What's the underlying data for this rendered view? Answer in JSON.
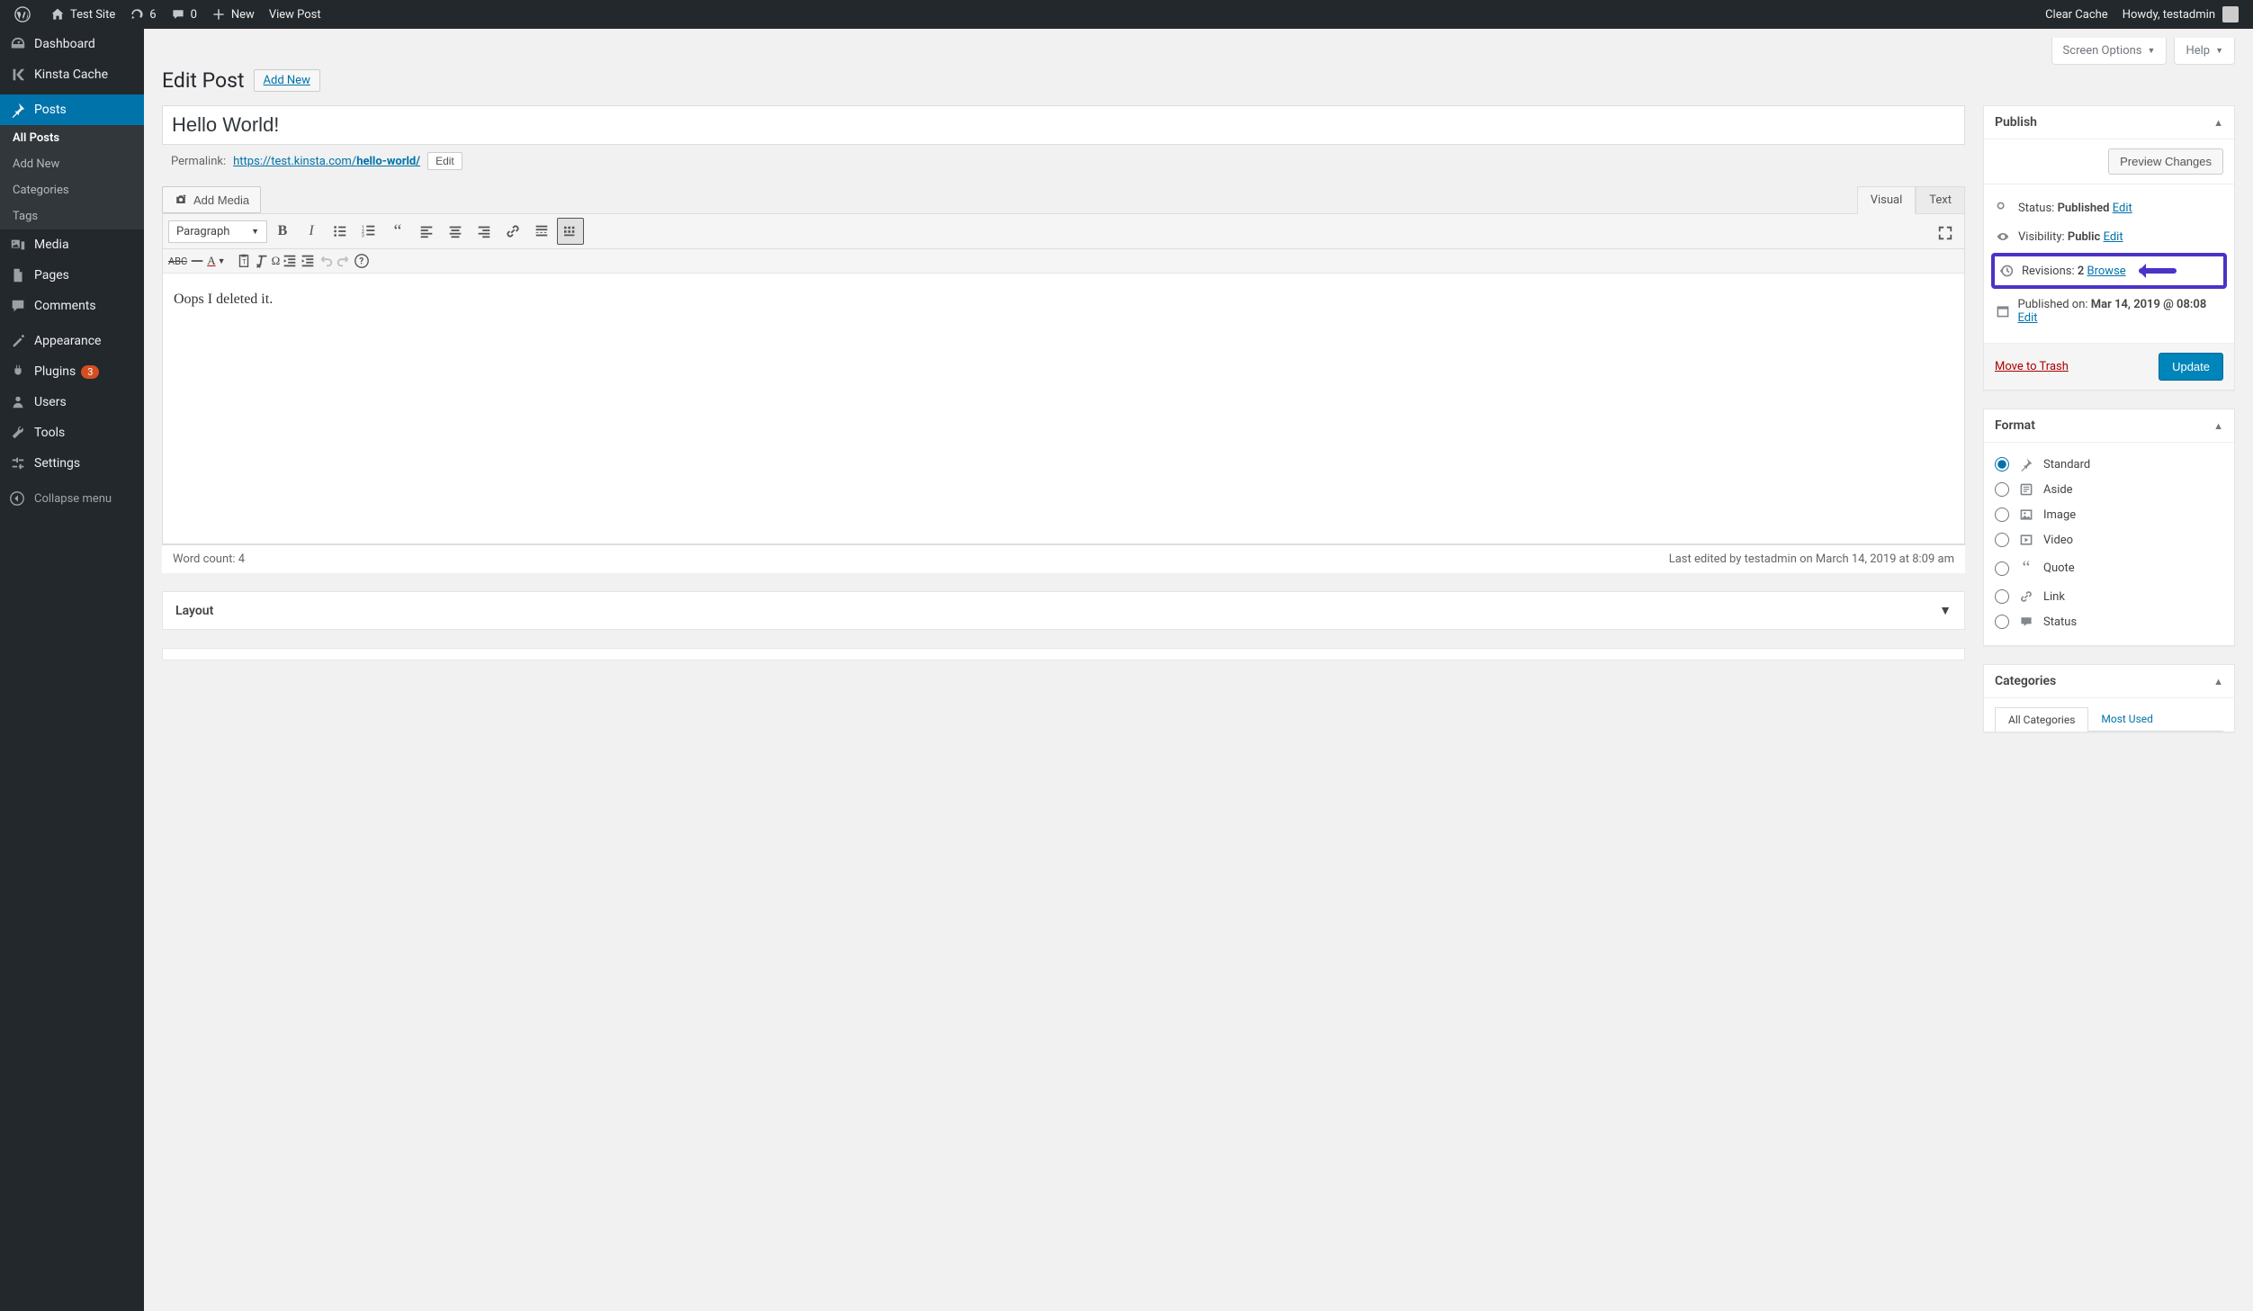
{
  "adminbar": {
    "site_name": "Test Site",
    "updates": "6",
    "comments": "0",
    "new": "New",
    "view_post": "View Post",
    "clear_cache": "Clear Cache",
    "howdy": "Howdy, testadmin"
  },
  "menu": {
    "dashboard": "Dashboard",
    "kinsta": "Kinsta Cache",
    "posts": "Posts",
    "posts_sub": {
      "all": "All Posts",
      "add": "Add New",
      "cats": "Categories",
      "tags": "Tags"
    },
    "media": "Media",
    "pages": "Pages",
    "comments": "Comments",
    "appearance": "Appearance",
    "plugins": "Plugins",
    "plugins_badge": "3",
    "users": "Users",
    "tools": "Tools",
    "settings": "Settings",
    "collapse": "Collapse menu"
  },
  "screen_meta": {
    "options": "Screen Options",
    "help": "Help"
  },
  "page": {
    "title": "Edit Post",
    "add_new": "Add New"
  },
  "post": {
    "title": "Hello World!",
    "permalink_label": "Permalink:",
    "permalink_base": "https://test.kinsta.com/",
    "permalink_slug": "hello-world/",
    "edit_btn": "Edit",
    "content": "Oops I deleted it."
  },
  "editor": {
    "add_media": "Add Media",
    "tab_visual": "Visual",
    "tab_text": "Text",
    "format_select": "Paragraph",
    "word_count_label": "Word count: 4",
    "last_edited": "Last edited by testadmin on March 14, 2019 at 8:09 am"
  },
  "publish": {
    "box_title": "Publish",
    "preview": "Preview Changes",
    "status_label": "Status:",
    "status_value": "Published",
    "visibility_label": "Visibility:",
    "visibility_value": "Public",
    "revisions_label": "Revisions:",
    "revisions_value": "2",
    "browse": "Browse",
    "published_on_label": "Published on:",
    "published_on_value": "Mar 14, 2019 @ 08:08",
    "edit": "Edit",
    "trash": "Move to Trash",
    "update": "Update"
  },
  "format": {
    "box_title": "Format",
    "standard": "Standard",
    "aside": "Aside",
    "image": "Image",
    "video": "Video",
    "quote": "Quote",
    "link": "Link",
    "status": "Status"
  },
  "categories": {
    "box_title": "Categories",
    "tab_all": "All Categories",
    "tab_most": "Most Used"
  },
  "layout": {
    "box_title": "Layout"
  }
}
